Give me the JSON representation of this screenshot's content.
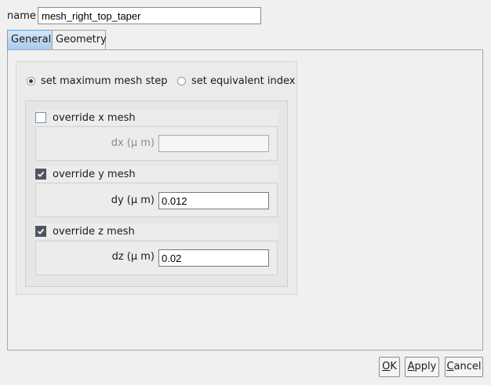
{
  "name_field": {
    "label": "name",
    "value": "mesh_right_top_taper"
  },
  "tabs": [
    {
      "label": "General",
      "active": true
    },
    {
      "label": "Geometry",
      "active": false
    }
  ],
  "mesh_mode": {
    "options": [
      {
        "label": "set maximum mesh step",
        "selected": true
      },
      {
        "label": "set equivalent index",
        "selected": false
      }
    ]
  },
  "overrides": {
    "x": {
      "checkbox_label": "override x mesh",
      "checked": false,
      "field_label": "dx (μ m)",
      "value": ""
    },
    "y": {
      "checkbox_label": "override y mesh",
      "checked": true,
      "field_label": "dy (μ m)",
      "value": "0.012"
    },
    "z": {
      "checkbox_label": "override z mesh",
      "checked": true,
      "field_label": "dz (μ m)",
      "value": "0.02"
    }
  },
  "buttons": {
    "ok": {
      "mnemonic": "O",
      "rest": "K"
    },
    "apply": {
      "mnemonic": "A",
      "rest": "pply"
    },
    "cancel": {
      "mnemonic": "C",
      "rest": "ancel"
    }
  },
  "colors": {
    "active_tab_top": "#d3e7f8",
    "active_tab_bottom": "#a9cbed",
    "checked_box": "#4e5560"
  },
  "icons": [
    "checkmark-icon",
    "radio-dot-icon"
  ]
}
